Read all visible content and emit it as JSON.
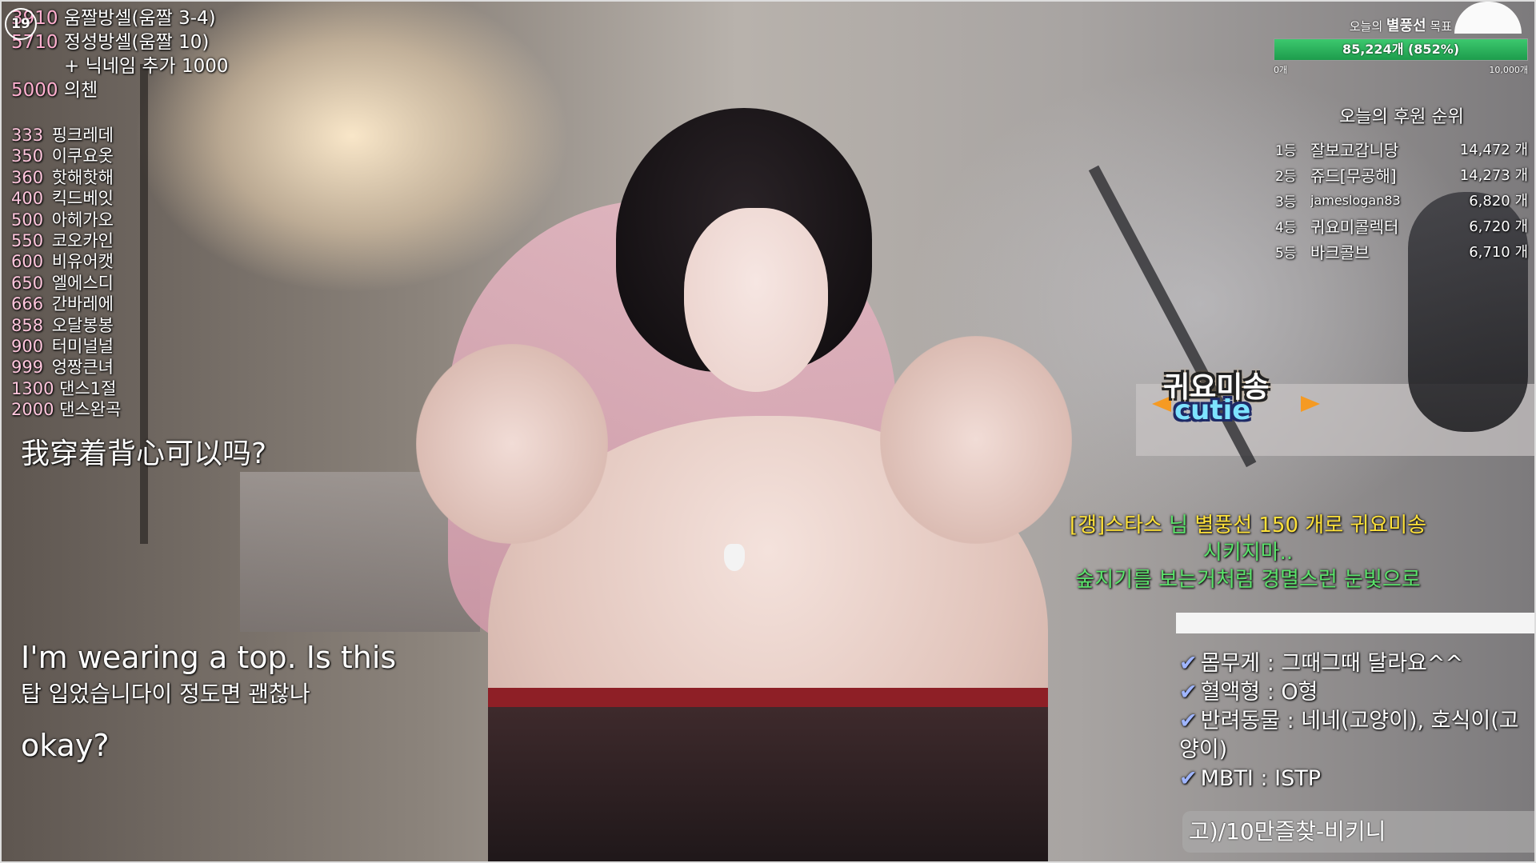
{
  "age_badge": "19",
  "top_left_menu": [
    {
      "num": "3910",
      "label": "움짤방셀(움짤 3-4)"
    },
    {
      "num": "5710",
      "label": "정성방셀(움짤 10)"
    },
    {
      "num": "",
      "label": "+ 닉네임 추가 1000"
    },
    {
      "num": "5000",
      "label": "의첸"
    }
  ],
  "menu_list": [
    {
      "num": "333",
      "label": "핑크레데"
    },
    {
      "num": "350",
      "label": "이쿠요옷"
    },
    {
      "num": "360",
      "label": "핫해핫해"
    },
    {
      "num": "400",
      "label": "킥드베잇"
    },
    {
      "num": "500",
      "label": "아헤가오"
    },
    {
      "num": "550",
      "label": "코오카인"
    },
    {
      "num": "600",
      "label": "비유어캣"
    },
    {
      "num": "650",
      "label": "엘에스디"
    },
    {
      "num": "666",
      "label": "간바레에"
    },
    {
      "num": "858",
      "label": "오달봉봉"
    },
    {
      "num": "900",
      "label": "터미널널"
    },
    {
      "num": "999",
      "label": "엉짱큰녀"
    },
    {
      "num": "1300",
      "label": "댄스1절"
    },
    {
      "num": "2000",
      "label": "댄스완곡"
    }
  ],
  "subtitles": {
    "chinese": "我穿着背心可以吗?",
    "english_line1": "I'm wearing a top. Is this",
    "korean": "탑 입었습니다이 정도면 괜찮나",
    "english_line2": "okay?"
  },
  "goal": {
    "title_prefix": "오늘의",
    "title_bold": "별풍선",
    "title_suffix": "목표",
    "value_text": "85,224개 (852%)",
    "fill_fraction": 1.0,
    "min_label": "0개",
    "max_label": "10,000개",
    "fill_color": "#1d9c4c"
  },
  "ranking": {
    "title": "오늘의 후원 순위",
    "rows": [
      {
        "rank": "1등",
        "name": "잘보고갑니당",
        "value": "14,472 개"
      },
      {
        "rank": "2등",
        "name": "쥬드[무공해]",
        "value": "14,273 개"
      },
      {
        "rank": "3등",
        "name": "jameslogan83",
        "value": "6,820 개"
      },
      {
        "rank": "4등",
        "name": "귀요미콜렉터",
        "value": "6,720 개"
      },
      {
        "rank": "5등",
        "name": "바크콜브",
        "value": "6,710 개"
      }
    ]
  },
  "sticker": {
    "top": "귀요미송",
    "bottom": "cutie"
  },
  "donation": {
    "sender": "[갱]스타스",
    "middle": " 님 ",
    "item": "별풍선 150 개로 귀요미송",
    "line2": "시키지마..",
    "line3": "숲지기를 보는거처럼 경멸스런 눈빛으로"
  },
  "info": [
    "몸무게 : 그때그때 달라요^^",
    "혈액형 : O형",
    "반려동물 : 네네(고양이), 호식이(고양이)",
    "MBTI : ISTP"
  ],
  "ticker": "고)/10만즐찾-비키니",
  "icons": {
    "check": "checkmark-icon",
    "moon": "moon-icon"
  }
}
